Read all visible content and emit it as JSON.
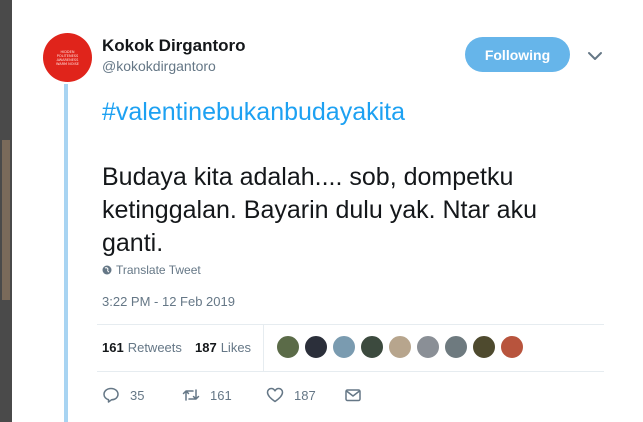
{
  "user": {
    "name": "Kokok Dirgantoro",
    "handle": "@kokokdirgantoro",
    "avatar_text": "Hidden. Politeness, Awareness and Personality of Warm Noise"
  },
  "follow_button": {
    "label": "Following"
  },
  "tweet": {
    "hashtag": "#valentinebukanbudayakita",
    "text": "Budaya kita adalah.... sob, dompetku ketinggalan. Bayarin dulu yak. Ntar aku ganti.",
    "translate_label": "Translate Tweet",
    "timestamp": "3:22 PM - 12 Feb 2019"
  },
  "stats": {
    "retweets_count": "161",
    "retweets_label": "Retweets",
    "likes_count": "187",
    "likes_label": "Likes"
  },
  "liker_avatars": [
    "#5b6b48",
    "#2b2f3a",
    "#7a9bb0",
    "#3c4a3e",
    "#b7a58d",
    "#8a8f96",
    "#6e7a7f",
    "#4e4a2e",
    "#b8543d"
  ],
  "actions": {
    "reply_count": "35",
    "retweet_count": "161",
    "like_count": "187"
  },
  "colors": {
    "accent": "#1da1f2",
    "follow_bg": "#66b5ea",
    "thread_line": "#a8d4f2",
    "avatar_bg": "#e0241b",
    "muted": "#657786"
  }
}
